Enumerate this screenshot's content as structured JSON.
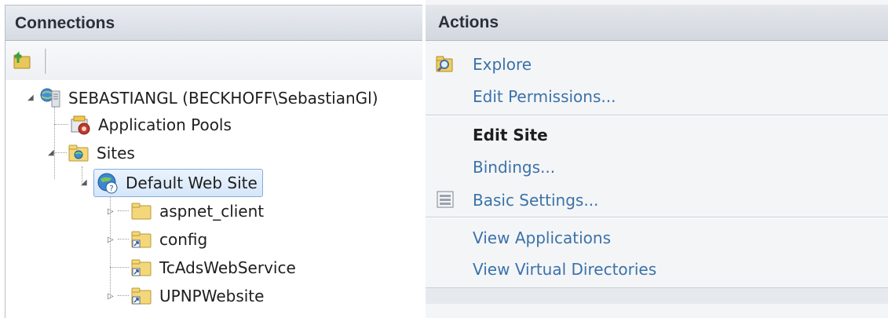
{
  "connections": {
    "header": "Connections",
    "toolbar": {
      "icons": [
        "create-connection-icon"
      ]
    },
    "tree": {
      "server": "SEBASTIANGL (BECKHOFF\\SebastianGl)",
      "app_pools": "Application Pools",
      "sites": "Sites",
      "default_site": "Default Web Site",
      "children": [
        "aspnet_client",
        "config",
        "TcAdsWebService",
        "UPNPWebsite"
      ]
    }
  },
  "actions": {
    "header": "Actions",
    "explore": "Explore",
    "edit_permissions": "Edit Permissions...",
    "edit_site_heading": "Edit Site",
    "bindings": "Bindings...",
    "basic_settings": "Basic Settings...",
    "view_applications": "View Applications",
    "view_virtual_directories": "View Virtual Directories"
  },
  "colors": {
    "link": "#3b72a9",
    "selection_fill": "#d5e6fa",
    "selection_border": "#84acdd"
  }
}
